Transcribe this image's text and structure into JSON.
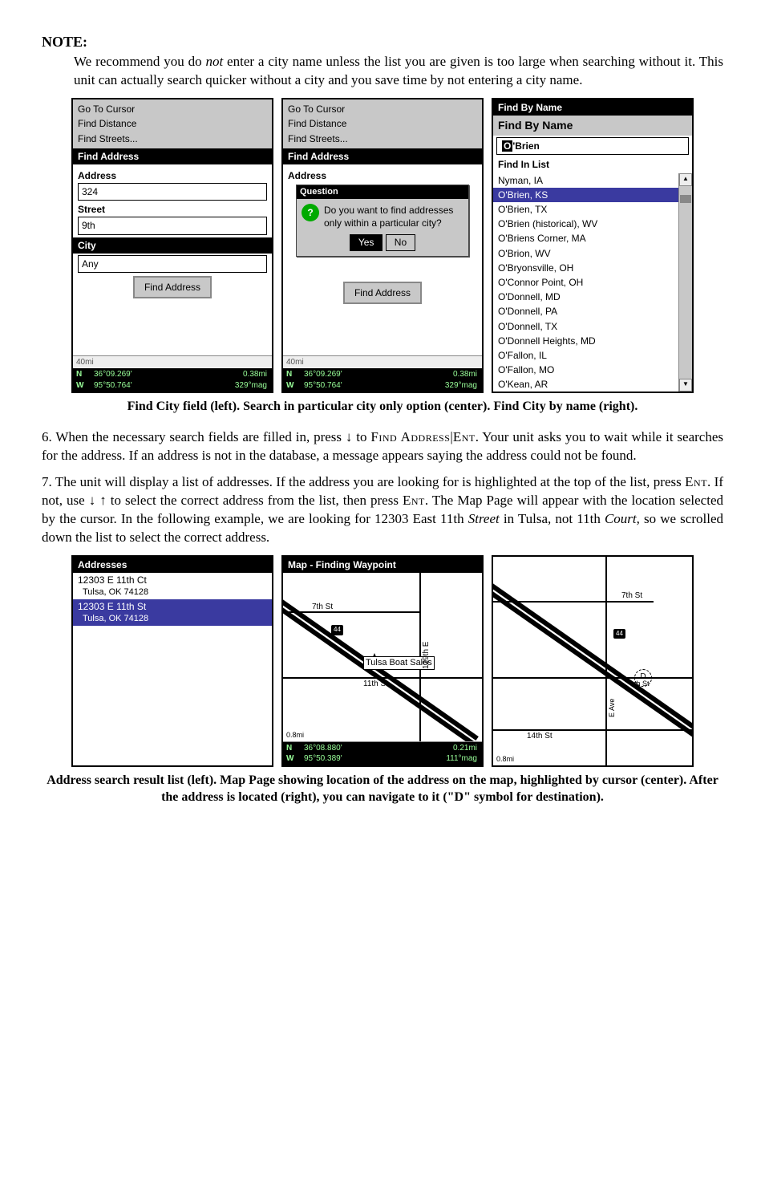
{
  "note": {
    "label": "NOTE:",
    "text_pre": "We recommend you do ",
    "text_not": "not",
    "text_post": " enter a city name unless the list you are given is too large when searching without it. This unit can actually search quicker without a city and you save time by not entering a city name."
  },
  "fig1": {
    "panelA": {
      "menu": [
        "Go To Cursor",
        "Find Distance",
        "Find Streets..."
      ],
      "title": "Find Address",
      "address_label": "Address",
      "address_value": "324",
      "street_label": "Street",
      "street_value": "9th",
      "city_label": "City",
      "city_value": "Any",
      "button": "Find Address",
      "scale": "40mi",
      "lat": "36°09.269'",
      "lon": "95°50.764'",
      "dist": "0.38mi",
      "brg": "329°mag"
    },
    "panelB": {
      "menu": [
        "Go To Cursor",
        "Find Distance",
        "Find Streets..."
      ],
      "title": "Find Address",
      "sub": "Address",
      "dialog_title": "Question",
      "dialog_text": "Do you want to find addresses only within a particular city?",
      "yes": "Yes",
      "no": "No",
      "button": "Find Address",
      "scale": "40mi",
      "lat": "36°09.269'",
      "lon": "95°50.764'",
      "dist": "0.38mi",
      "brg": "329°mag"
    },
    "panelC": {
      "title_top": "Find By Name",
      "title": "Find By Name",
      "input": "O 'Brien",
      "list_label": "Find In List",
      "items": [
        "Nyman, IA",
        "O'Brien, KS",
        "O'Brien, TX",
        "O'Brien (historical), WV",
        "O'Briens Corner, MA",
        "O'Brion, WV",
        "O'Bryonsville, OH",
        "O'Connor Point, OH",
        "O'Donnell, MD",
        "O'Donnell, PA",
        "O'Donnell, TX",
        "O'Donnell Heights, MD",
        "O'Fallon, IL",
        "O'Fallon, MO",
        "O'Kean, AR"
      ]
    },
    "caption": "Find City field (left). Search in particular city only option (center). Find City by name (right)."
  },
  "step6": {
    "prefix": "6. When the necessary search fields are filled in, press ↓ to ",
    "find_label": "Find Address",
    "mid": "|",
    "ent": "Ent",
    "post": ". Your unit asks you to wait while it searches for the address. If an address is not in the database, a message appears saying the address could not be found."
  },
  "step7": {
    "t1": "7. The unit will display a list of addresses. If the address you are looking for is highlighted at the top of the list, press ",
    "ent1": "Ent",
    "t2": ". If not, use ↓ ↑ to select the correct address from the list, then press ",
    "ent2": "Ent",
    "t3": ". The Map Page will appear with the location selected by the cursor. In the following example, we are looking for 12303 East 11th ",
    "street_i": "Street",
    "t4": " in Tulsa, not 11th ",
    "court_i": "Court",
    "t5": ", so we scrolled down the list to select the correct address."
  },
  "fig2": {
    "panelA": {
      "title": "Addresses",
      "row1a": "12303 E 11th Ct",
      "row1b": "Tulsa, OK   74128",
      "row2a": "12303 E 11th St",
      "row2b": "Tulsa, OK   74128"
    },
    "panelB": {
      "title": "Map - Finding Waypoint",
      "poi": "Tulsa Boat Sales",
      "st1": "11th St",
      "st2": "129th E",
      "st3": "7th St",
      "shield": "44",
      "scale": "0.8mi",
      "lat": "36°08.880'",
      "lon": "95°50.389'",
      "dist": "0.21mi",
      "brg": "111°mag"
    },
    "panelC": {
      "st1": "11th St",
      "st2": "14th St",
      "st3": "7th St",
      "st4": "E Ave",
      "shield": "44",
      "scale": "0.8mi",
      "dest": "D"
    },
    "caption": "Address search result list (left). Map Page showing location of the address on the map, highlighted by cursor (center). After the address is located (right), you can navigate to it (\"D\" symbol for destination)."
  }
}
